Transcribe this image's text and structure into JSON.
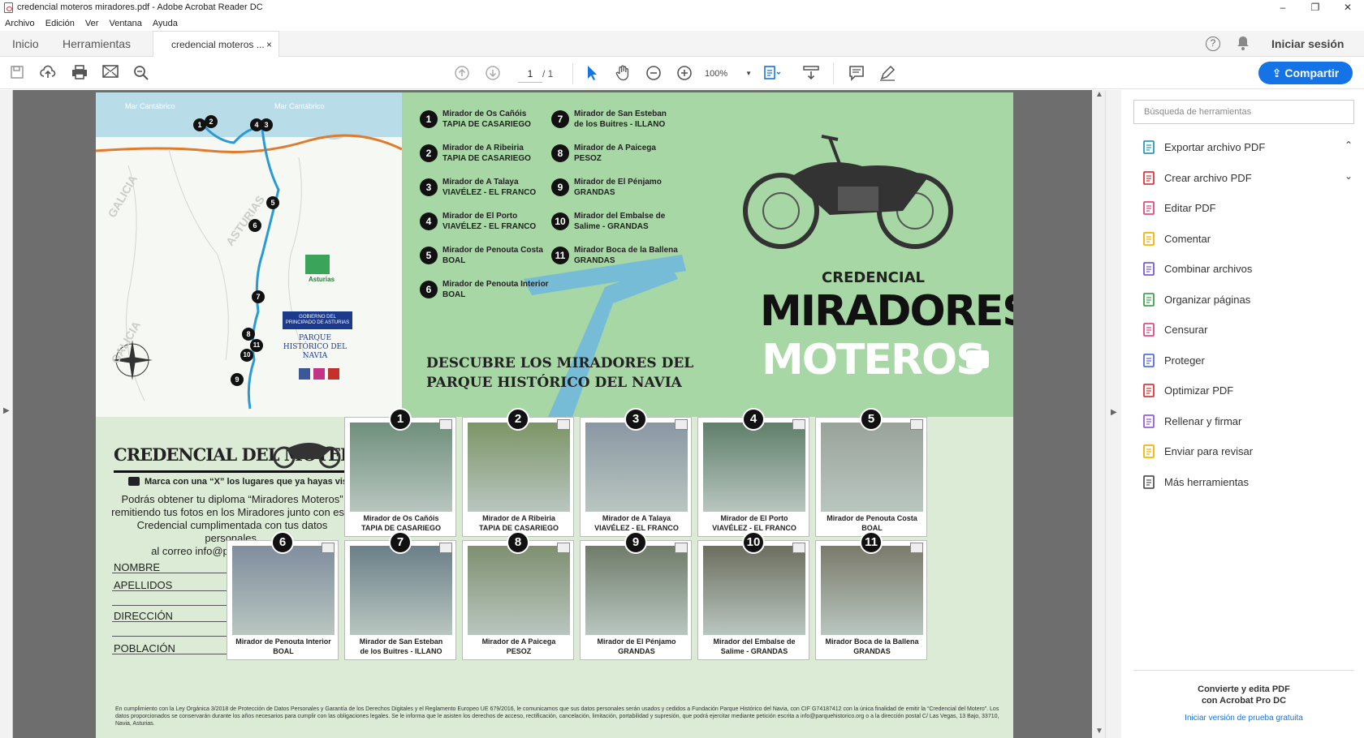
{
  "window": {
    "title": "credencial moteros miradores.pdf - Adobe Acrobat Reader DC"
  },
  "menu": [
    "Archivo",
    "Edición",
    "Ver",
    "Ventana",
    "Ayuda"
  ],
  "tabs": {
    "home": "Inicio",
    "tools": "Herramientas",
    "doc": "credencial moteros ...",
    "close": "×"
  },
  "header": {
    "signin": "Iniciar sesión",
    "help": "?"
  },
  "toolbar": {
    "page_current": "1",
    "page_total": "/ 1",
    "zoom": "100%",
    "share": "Compartir"
  },
  "document": {
    "map_labels": {
      "sea_left": "Mar Cantábrico",
      "sea_right": "Mar Cantábrico",
      "galicia": "GALICIA",
      "asturias": "ASTURIAS",
      "galicia2": "GALICIA",
      "parque": "PARQUE HISTÓRICO DEL NAVIA",
      "gobierno": "GOBIERNO DEL PRINCIPADO DE ASTURIAS",
      "asturias_logo": "Asturias"
    },
    "miradores": [
      {
        "n": "1",
        "name": "Mirador de Os Cañóis",
        "place": "TAPIA DE CASARIEGO"
      },
      {
        "n": "2",
        "name": "Mirador de A Ribeiria",
        "place": "TAPIA DE CASARIEGO"
      },
      {
        "n": "3",
        "name": "Mirador de A Talaya",
        "place": "VIAVÉLEZ - EL FRANCO"
      },
      {
        "n": "4",
        "name": "Mirador de El Porto",
        "place": "VIAVÉLEZ - EL FRANCO"
      },
      {
        "n": "5",
        "name": "Mirador de Penouta Costa",
        "place": "BOAL"
      },
      {
        "n": "6",
        "name": "Mirador de Penouta Interior",
        "place": "BOAL"
      },
      {
        "n": "7",
        "name": "Mirador de San Esteban de los Buitres",
        "place": "ILLANO"
      },
      {
        "n": "8",
        "name": "Mirador de A Paicega",
        "place": "PESOZ"
      },
      {
        "n": "9",
        "name": "Mirador de El Pénjamo",
        "place": "GRANDAS"
      },
      {
        "n": "10",
        "name": "Mirador del Embalse de Salime",
        "place": "GRANDAS"
      },
      {
        "n": "11",
        "name": "Mirador Boca de la Ballena",
        "place": "GRANDAS"
      }
    ],
    "list_col1": [
      {
        "n": "1",
        "l1": "Mirador de Os Cañóis",
        "l2": "TAPIA DE CASARIEGO"
      },
      {
        "n": "2",
        "l1": "Mirador de A Ribeiria",
        "l2": "TAPIA DE CASARIEGO"
      },
      {
        "n": "3",
        "l1": "Mirador de A Talaya",
        "l2": "VIAVÉLEZ - EL FRANCO"
      },
      {
        "n": "4",
        "l1": "Mirador de El Porto",
        "l2": "VIAVÉLEZ - EL FRANCO"
      },
      {
        "n": "5",
        "l1": "Mirador de Penouta Costa",
        "l2": "BOAL"
      },
      {
        "n": "6",
        "l1": "Mirador de Penouta Interior",
        "l2": "BOAL"
      }
    ],
    "list_col2": [
      {
        "n": "7",
        "l1": "Mirador de San Esteban",
        "l2": "de los Buitres - ILLANO"
      },
      {
        "n": "8",
        "l1": "Mirador de A Paicega",
        "l2": "PESOZ"
      },
      {
        "n": "9",
        "l1": "Mirador de El Pénjamo",
        "l2": "GRANDAS"
      },
      {
        "n": "10",
        "l1": "Mirador del Embalse de",
        "l2": "Salime - GRANDAS"
      },
      {
        "n": "11",
        "l1": "Mirador Boca de la Ballena",
        "l2": "GRANDAS"
      }
    ],
    "slogan1": "DESCUBRE LOS MIRADORES DEL",
    "slogan2": "PARQUE HISTÓRICO DEL NAVIA",
    "cred_small": "CREDENCIAL",
    "cred_big": "MIRADORES",
    "cred_moteros": "MOTEROS",
    "lower_title": "CREDENCIAL DEL MOTERO",
    "mark_text": "Marca con una “X” los lugares que ya hayas visitado",
    "promo_lines": [
      "Podrás obtener tu diploma “Miradores Moteros”",
      "remitiendo tus fotos en los Miradores junto con esta",
      "Credencial cumplimentada con tus datos personales,",
      "al correo info@parquehistorico.org"
    ],
    "form": {
      "nombre": "NOMBRE",
      "apellidos": "APELLIDOS",
      "direccion": "DIRECCIÓN",
      "poblacion": "POBLACIÓN"
    },
    "cards_row1": [
      {
        "n": "1",
        "l1": "Mirador de Os Cañóis",
        "l2": "TAPIA DE CASARIEGO"
      },
      {
        "n": "2",
        "l1": "Mirador de A Ribeiria",
        "l2": "TAPIA DE CASARIEGO"
      },
      {
        "n": "3",
        "l1": "Mirador de A Talaya",
        "l2": "VIAVÉLEZ - EL FRANCO"
      },
      {
        "n": "4",
        "l1": "Mirador de El Porto",
        "l2": "VIAVÉLEZ - EL FRANCO"
      },
      {
        "n": "5",
        "l1": "Mirador de Penouta Costa",
        "l2": "BOAL"
      }
    ],
    "cards_row2": [
      {
        "n": "6",
        "l1": "Mirador de Penouta Interior",
        "l2": "BOAL"
      },
      {
        "n": "7",
        "l1": "Mirador de San Esteban",
        "l2": "de los Buitres - ILLANO"
      },
      {
        "n": "8",
        "l1": "Mirador de A Paicega",
        "l2": "PESOZ"
      },
      {
        "n": "9",
        "l1": "Mirador de El Pénjamo",
        "l2": "GRANDAS"
      },
      {
        "n": "10",
        "l1": "Mirador del Embalse de",
        "l2": "Salime - GRANDAS"
      },
      {
        "n": "11",
        "l1": "Mirador Boca de la Ballena",
        "l2": "GRANDAS"
      }
    ],
    "legal": "En cumplimiento con la Ley Orgánica 3/2018 de Protección de Datos Personales y Garantía de los Derechos Digitales y el Reglamento Europeo UE 679/2016, le comunicamos que sus datos personales serán usados y cedidos a Fundación Parque Histórico del Navia, con CIF G74187412 con la única finalidad de emitir la “Credencial del Motero”. Los datos proporcionados se conservarán durante los años necesarios para cumplir con las obligaciones legales. Se le informa que le asisten los derechos de acceso, rectificación, cancelación, limitación, portabilidad y supresión, que podrá ejercitar mediante petición escrita a info@parquehistorico.org o a la dirección postal C/ Las Vegas, 13 Bajo, 33710, Navia, Asturias."
  },
  "rightpane": {
    "search_placeholder": "Búsqueda de herramientas",
    "tools": [
      {
        "label": "Exportar archivo PDF",
        "icon": "export-pdf-icon",
        "color": "#2e9cb5"
      },
      {
        "label": "Crear archivo PDF",
        "icon": "create-pdf-icon",
        "color": "#e0373c"
      },
      {
        "label": "Editar PDF",
        "icon": "edit-pdf-icon",
        "color": "#e44b80"
      },
      {
        "label": "Comentar",
        "icon": "comment-icon",
        "color": "#f4b400"
      },
      {
        "label": "Combinar archivos",
        "icon": "combine-icon",
        "color": "#7b5cd6"
      },
      {
        "label": "Organizar páginas",
        "icon": "organize-icon",
        "color": "#40a64d"
      },
      {
        "label": "Censurar",
        "icon": "redact-icon",
        "color": "#e44b80"
      },
      {
        "label": "Proteger",
        "icon": "protect-icon",
        "color": "#5a6ee0"
      },
      {
        "label": "Optimizar PDF",
        "icon": "optimize-icon",
        "color": "#e0373c"
      },
      {
        "label": "Rellenar y firmar",
        "icon": "fill-sign-icon",
        "color": "#9b5cd6"
      },
      {
        "label": "Enviar para revisar",
        "icon": "send-review-icon",
        "color": "#f4b400"
      },
      {
        "label": "Más herramientas",
        "icon": "more-tools-icon",
        "color": "#555555"
      }
    ],
    "promo1": "Convierte y edita PDF",
    "promo2": "con Acrobat Pro DC",
    "promo_link": "Iniciar versión de prueba gratuita"
  }
}
